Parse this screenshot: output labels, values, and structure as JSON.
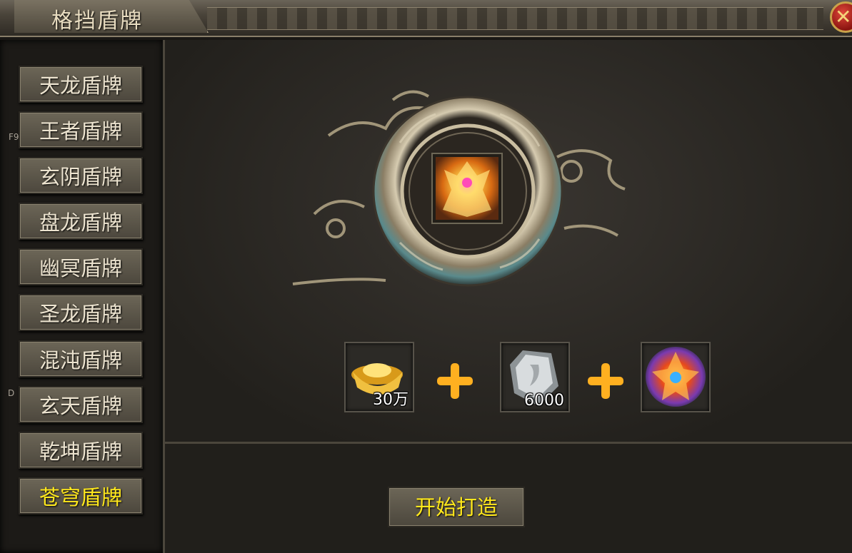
{
  "window": {
    "title": "格挡盾牌",
    "close_icon": "close-icon"
  },
  "sidebar": {
    "items": [
      {
        "label": "天龙盾牌",
        "active": false
      },
      {
        "label": "王者盾牌",
        "active": false
      },
      {
        "label": "玄阴盾牌",
        "active": false
      },
      {
        "label": "盘龙盾牌",
        "active": false
      },
      {
        "label": "幽冥盾牌",
        "active": false
      },
      {
        "label": "圣龙盾牌",
        "active": false
      },
      {
        "label": "混沌盾牌",
        "active": false
      },
      {
        "label": "玄天盾牌",
        "active": false
      },
      {
        "label": "乾坤盾牌",
        "active": false
      },
      {
        "label": "苍穹盾牌",
        "active": true
      }
    ],
    "hotkeys": [
      "F9",
      "D"
    ]
  },
  "recipe": {
    "target_icon": "shield-item-icon",
    "materials": [
      {
        "icon": "gold-ingot-icon",
        "count": "30万"
      },
      {
        "icon": "shield-fragment-icon",
        "count": "6000"
      },
      {
        "icon": "dragon-shield-icon",
        "count": ""
      }
    ],
    "plus_icon": "plus-icon"
  },
  "actions": {
    "craft_label": "开始打造"
  },
  "colors": {
    "active_text": "#ffe81c",
    "text": "#ece3cf",
    "plus": "#ffb020"
  }
}
